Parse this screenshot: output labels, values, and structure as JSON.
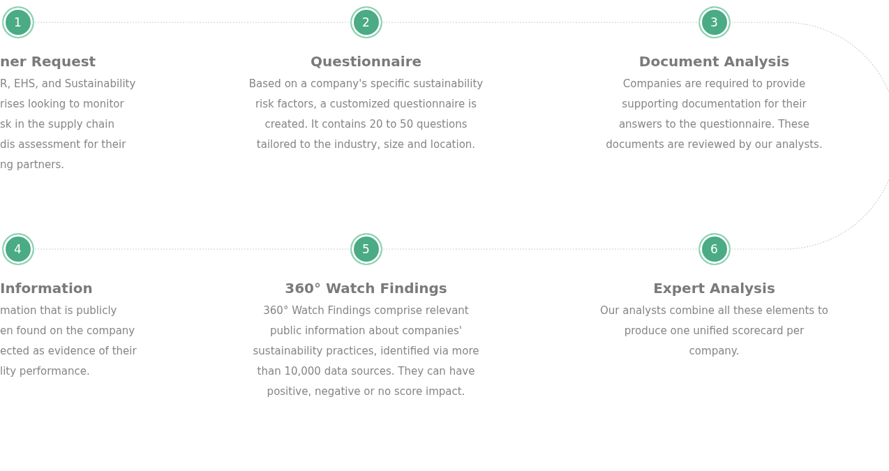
{
  "steps": [
    {
      "number": "1",
      "title": "ner Request",
      "lines": [
        "R, EHS, and Sustainability",
        "rises looking to monitor",
        "sk in the supply chain",
        "dis assessment for their",
        "ng partners."
      ]
    },
    {
      "number": "2",
      "title": "Questionnaire",
      "lines": [
        "Based on a company's specific sustainability",
        "risk factors, a customized questionnaire is",
        "created. It contains 20 to 50 questions",
        "tailored to the industry, size and location."
      ]
    },
    {
      "number": "3",
      "title": "Document Analysis",
      "lines": [
        "Companies are required to provide",
        "supporting documentation for their",
        "answers to the questionnaire. These",
        "documents are reviewed by our analysts."
      ]
    },
    {
      "number": "4",
      "title": "Information",
      "lines": [
        "mation that is publicly",
        "en found on the company",
        "ected as evidence of their",
        "lity performance."
      ]
    },
    {
      "number": "5",
      "title": "360° Watch Findings",
      "lines": [
        "360° Watch Findings comprise relevant",
        "public information about companies'",
        "sustainability practices, identified via more",
        "than 10,000 data sources. They can have",
        "positive, negative or no score impact."
      ]
    },
    {
      "number": "6",
      "title": "Expert Analysis",
      "lines": [
        "Our analysts combine all these elements to",
        "produce one unified scorecard per",
        "company."
      ]
    }
  ]
}
